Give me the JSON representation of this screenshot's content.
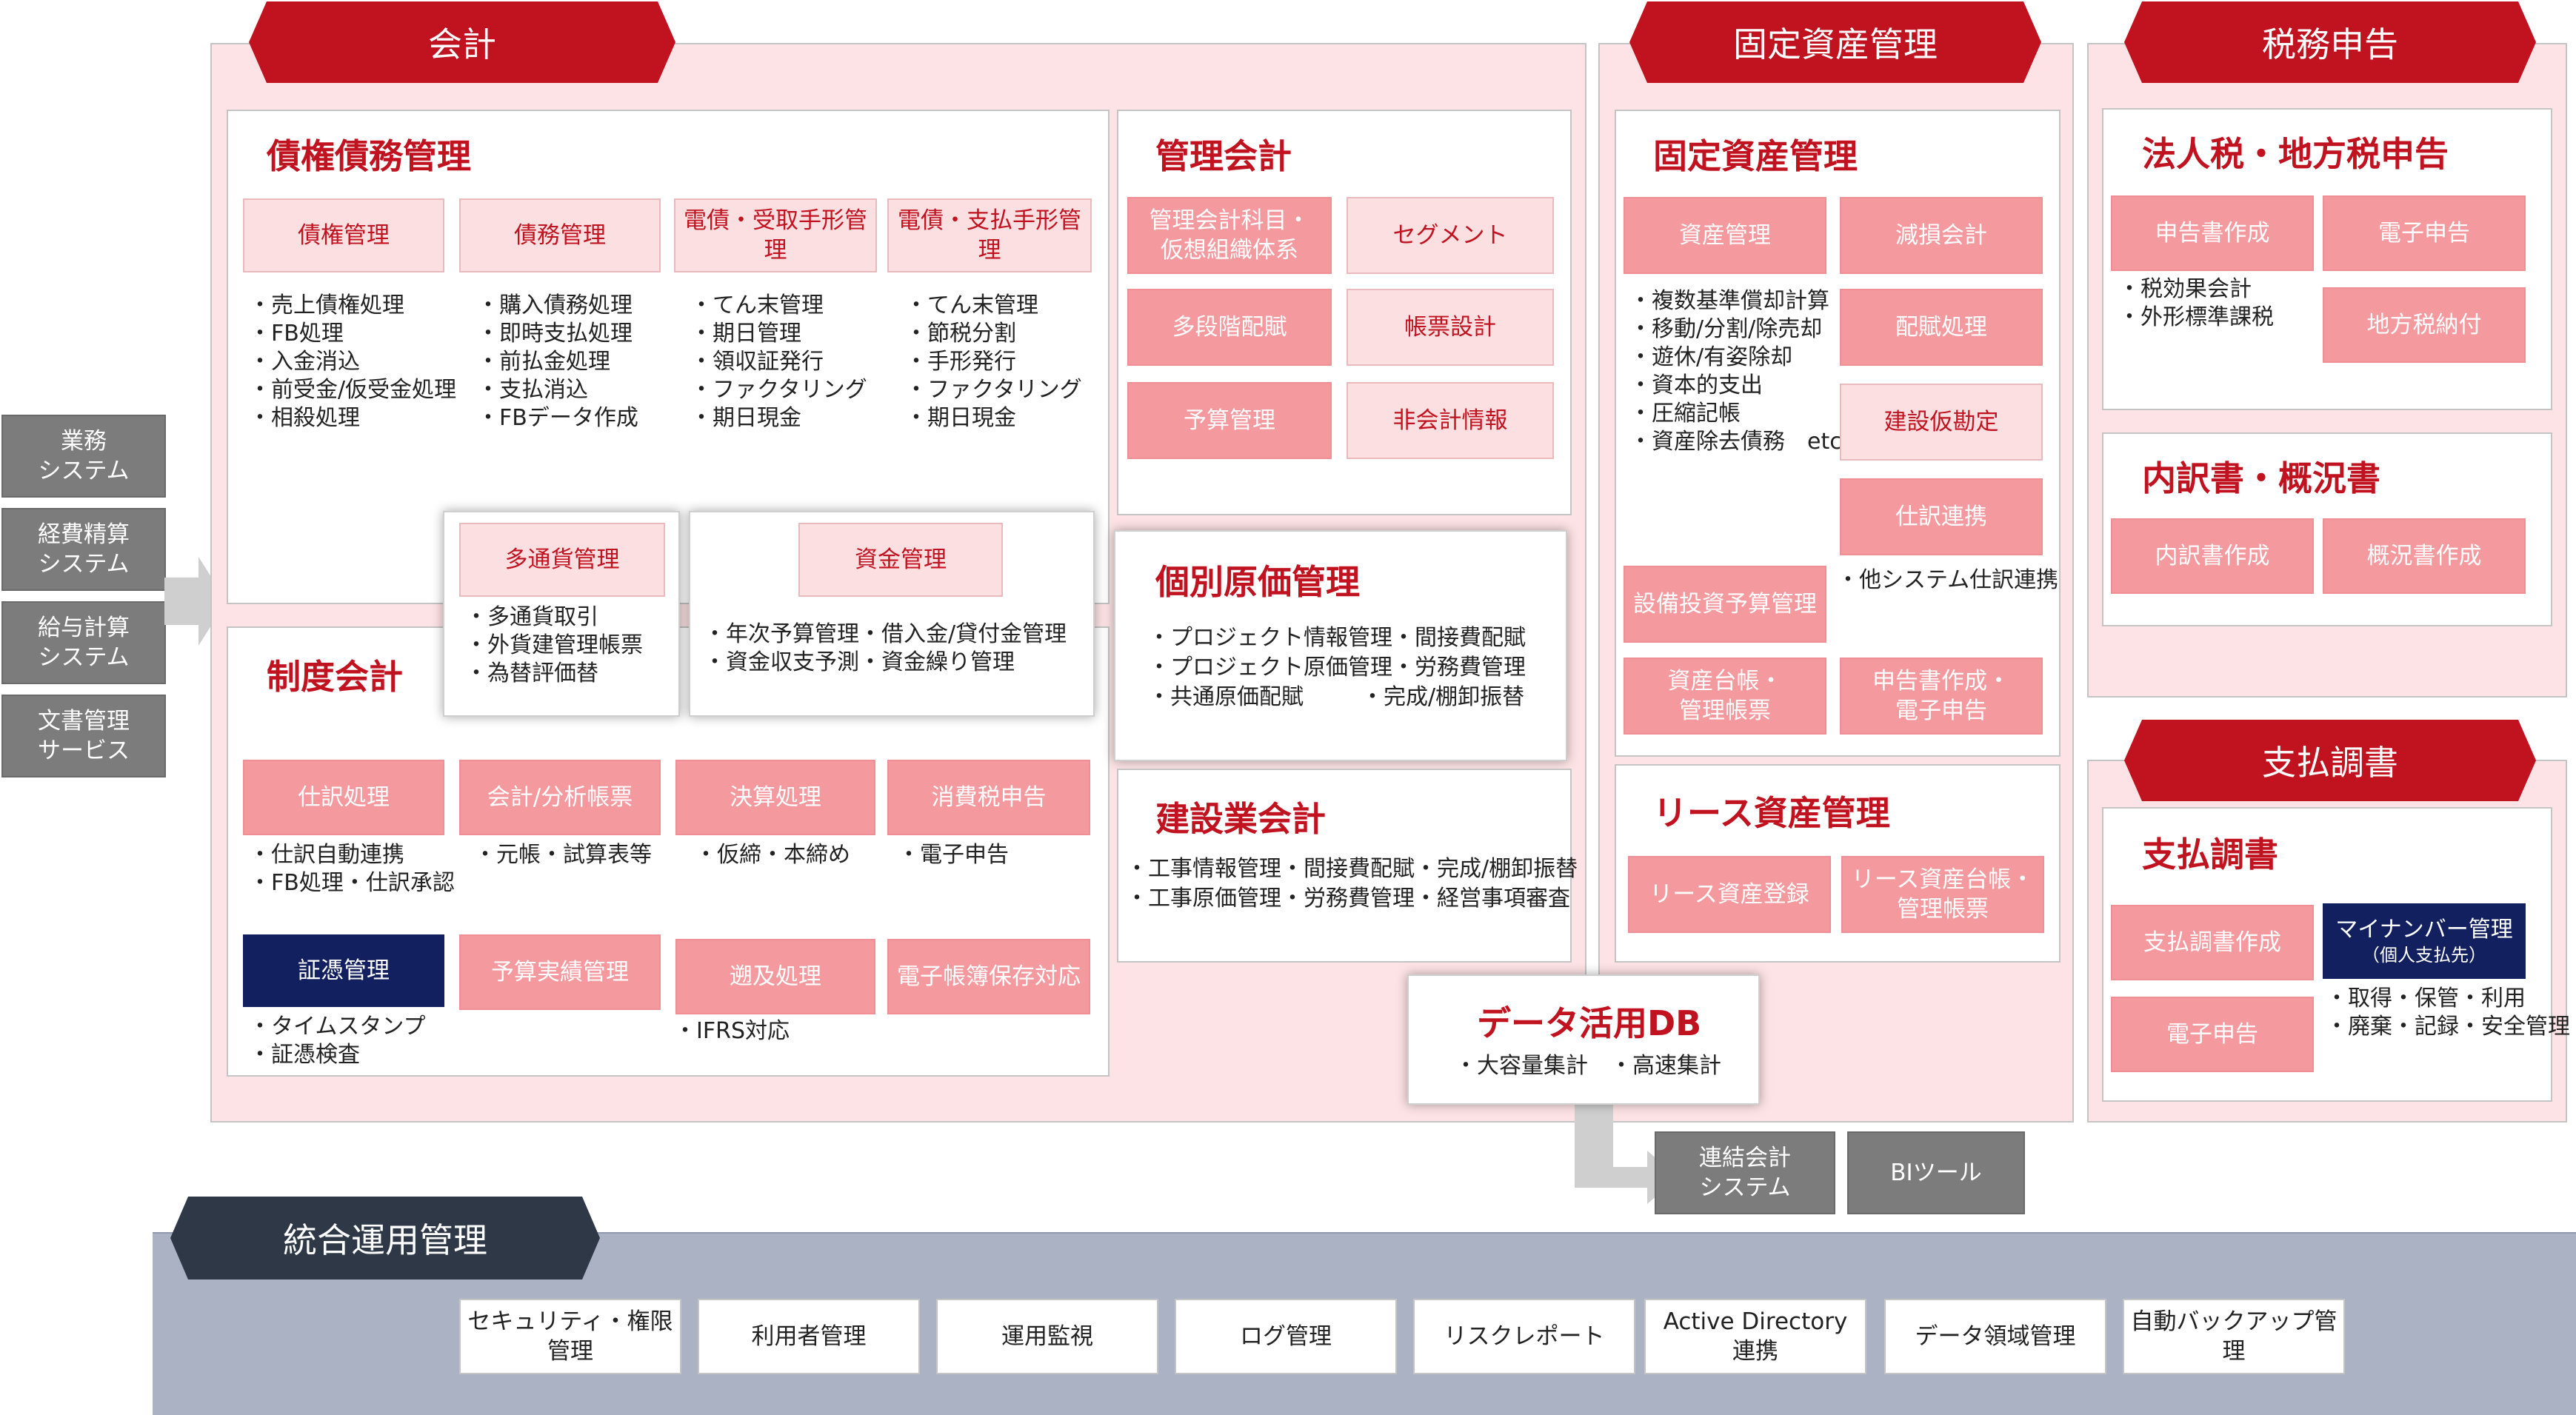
{
  "left_sources": [
    "業務\nシステム",
    "経費精算\nシステム",
    "給与計算\nシステム",
    "文書管理\nサービス"
  ],
  "kaikei": {
    "banner": "会計",
    "saiken": {
      "title": "債権債務管理",
      "modules": [
        {
          "label": "債権管理",
          "items": [
            "・売上債権処理",
            "・FB処理",
            "・入金消込",
            "・前受金/仮受金処理",
            "・相殺処理"
          ]
        },
        {
          "label": "債務管理",
          "items": [
            "・購入債務処理",
            "・即時支払処理",
            "・前払金処理",
            "・支払消込",
            "・FBデータ作成"
          ]
        },
        {
          "label": "電債・受取手形管理",
          "items": [
            "・てん末管理",
            "・期日管理",
            "・領収証発行",
            "・ファクタリング",
            "・期日現金"
          ]
        },
        {
          "label": "電債・支払手形管理",
          "items": [
            "・てん末管理",
            "・節税分割",
            "・手形発行",
            "・ファクタリング",
            "・期日現金"
          ]
        }
      ]
    },
    "tasuka": {
      "label": "多通貨管理",
      "items": [
        "・多通貨取引",
        "・外貨建管理帳票",
        "・為替評価替"
      ]
    },
    "shikin": {
      "label": "資金管理",
      "items": [
        "・年次予算管理・借入金/貸付金管理",
        "・資金収支予測・資金繰り管理"
      ]
    },
    "seido": {
      "title": "制度会計",
      "modules": [
        {
          "label": "仕訳処理",
          "items": [
            "・仕訳自動連携",
            "・FB処理・仕訳承認"
          ]
        },
        {
          "label": "会計/分析帳票",
          "items": [
            "・元帳・試算表等"
          ]
        },
        {
          "label": "決算処理",
          "items": [
            "・仮締・本締め"
          ]
        },
        {
          "label": "消費税申告",
          "items": [
            "・電子申告"
          ]
        },
        {
          "label": "証憑管理",
          "items": [
            "・タイムスタンプ",
            "・証憑検査"
          ]
        },
        {
          "label": "予算実績管理",
          "items": []
        },
        {
          "label": "遡及処理",
          "items": [
            "・IFRS対応"
          ]
        },
        {
          "label": "電子帳簿保存対応",
          "items": []
        }
      ]
    },
    "kanri": {
      "title": "管理会計",
      "buttons": [
        "管理会計科目・\n仮想組織体系",
        "セグメント",
        "多段階配賦",
        "帳票設計",
        "予算管理",
        "非会計情報"
      ]
    },
    "kobetsu": {
      "title": "個別原価管理",
      "lines": [
        "・プロジェクト情報管理・間接費配賦",
        "・プロジェクト原価管理・労務費管理"
      ],
      "line3a": "・共通原価配賦",
      "line3b": "・完成/棚卸振替"
    },
    "kensetsu": {
      "title": "建設業会計",
      "lines": [
        "・工事情報管理・間接費配賦・完成/棚卸振替",
        "・工事原価管理・労務費管理・経営事項審査"
      ]
    }
  },
  "kotei": {
    "banner": "固定資産管理",
    "panel": {
      "title": "固定資産管理",
      "buttons": [
        "資産管理",
        "減損会計",
        "配賦処理",
        "建設仮勘定",
        "仕訳連携",
        "設備投資予算管理",
        "資産台帳・\n管理帳票",
        "申告書作成・\n電子申告"
      ],
      "items": [
        "・複数基準償却計算",
        "・移動/分割/除売却",
        "・遊休/有姿除却",
        "・資本的支出",
        "・圧縮記帳",
        "・資産除去債務　etc."
      ],
      "renkei_note": "・他システム仕訳連携"
    },
    "lease": {
      "title": "リース資産管理",
      "buttons": [
        "リース資産登録",
        "リース資産台帳・\n管理帳票"
      ]
    }
  },
  "zeimu": {
    "banner": "税務申告",
    "hojin": {
      "title": "法人税・地方税申告",
      "buttons": [
        "申告書作成",
        "電子申告",
        "地方税納付"
      ],
      "items": [
        "・税効果会計",
        "・外形標準課税"
      ]
    },
    "uchiwake": {
      "title": "内訳書・概況書",
      "buttons": [
        "内訳書作成",
        "概況書作成"
      ]
    }
  },
  "shiharai": {
    "banner": "支払調書",
    "title": "支払調書",
    "buttons": [
      "支払調書作成",
      "電子申告"
    ],
    "mynumber_label": "マイナンバー管理",
    "mynumber_sub": "（個人支払先）",
    "items": [
      "・取得・保管・利用",
      "・廃棄・記録・安全管理"
    ]
  },
  "db": {
    "title": "データ活用DB",
    "items": "・大容量集計　・高速集計"
  },
  "outputs": [
    "連結会計\nシステム",
    "BIツール"
  ],
  "togo": {
    "banner": "統合運用管理",
    "items": [
      "セキュリティ・権限管理",
      "利用者管理",
      "運用監視",
      "ログ管理",
      "リスクレポート",
      "Active Directory\n連携",
      "データ領域管理",
      "自動バックアップ管理"
    ]
  },
  "colors": {
    "accent_red": "#c1121f",
    "section_pink": "#fde3e5",
    "button_pink": "#f49a9f",
    "navy": "#13205f",
    "dark_banner": "#2e3847",
    "bottom_band": "#aab2c4",
    "gray_box": "#7c7c7c"
  }
}
